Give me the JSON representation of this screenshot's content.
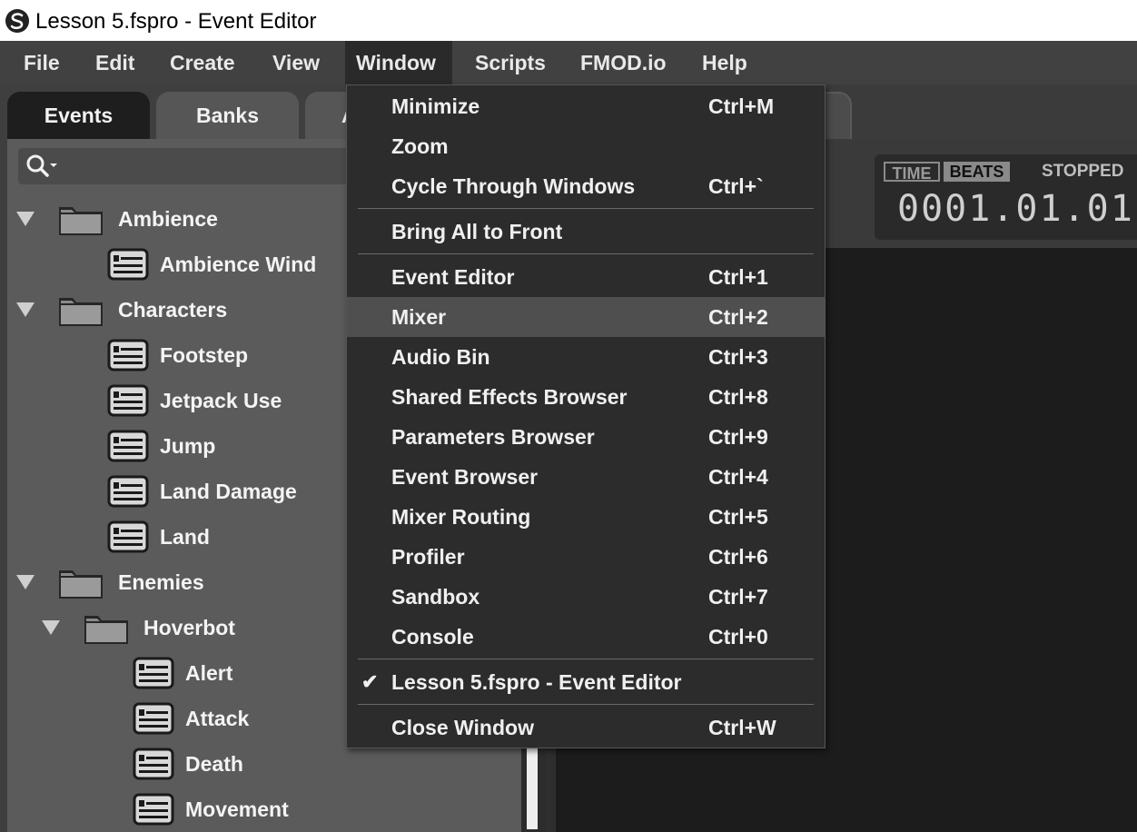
{
  "window": {
    "title": "Lesson 5.fspro - Event Editor"
  },
  "menubar": {
    "items": [
      "File",
      "Edit",
      "Create",
      "View",
      "Window",
      "Scripts",
      "FMOD.io",
      "Help"
    ],
    "open": "Window"
  },
  "browser": {
    "tabs": [
      "Events",
      "Banks",
      "A"
    ],
    "active_tab": "Events",
    "tree": [
      {
        "label": "Ambience",
        "type": "folder",
        "depth": 0,
        "expanded": true
      },
      {
        "label": "Ambience Wind",
        "type": "event",
        "depth": 1
      },
      {
        "label": "Characters",
        "type": "folder",
        "depth": 0,
        "expanded": true
      },
      {
        "label": "Footstep",
        "type": "event",
        "depth": 1
      },
      {
        "label": "Jetpack Use",
        "type": "event",
        "depth": 1
      },
      {
        "label": "Jump",
        "type": "event",
        "depth": 1
      },
      {
        "label": "Land Damage",
        "type": "event",
        "depth": 1
      },
      {
        "label": "Land",
        "type": "event",
        "depth": 1
      },
      {
        "label": "Enemies",
        "type": "folder",
        "depth": 0,
        "expanded": true
      },
      {
        "label": "Hoverbot",
        "type": "folder",
        "depth": 1,
        "expanded": true
      },
      {
        "label": "Alert",
        "type": "event",
        "depth": 2
      },
      {
        "label": "Attack",
        "type": "event",
        "depth": 2
      },
      {
        "label": "Death",
        "type": "event",
        "depth": 2
      },
      {
        "label": "Movement",
        "type": "event",
        "depth": 2
      }
    ]
  },
  "transport": {
    "time_label": "TIME",
    "beats_label": "BEATS",
    "status": "STOPPED",
    "position": "0001.01.01"
  },
  "window_menu": {
    "items": [
      {
        "label": "Minimize",
        "shortcut": "Ctrl+M"
      },
      {
        "label": "Zoom",
        "shortcut": ""
      },
      {
        "label": "Cycle Through Windows",
        "shortcut": "Ctrl+`"
      },
      {
        "label": "Bring All to Front",
        "shortcut": ""
      },
      {
        "label": "Event Editor",
        "shortcut": "Ctrl+1"
      },
      {
        "label": "Mixer",
        "shortcut": "Ctrl+2",
        "highlighted": true
      },
      {
        "label": "Audio Bin",
        "shortcut": "Ctrl+3"
      },
      {
        "label": "Shared Effects Browser",
        "shortcut": "Ctrl+8"
      },
      {
        "label": "Parameters Browser",
        "shortcut": "Ctrl+9"
      },
      {
        "label": "Event Browser",
        "shortcut": "Ctrl+4"
      },
      {
        "label": "Mixer Routing",
        "shortcut": "Ctrl+5"
      },
      {
        "label": "Profiler",
        "shortcut": "Ctrl+6"
      },
      {
        "label": "Sandbox",
        "shortcut": "Ctrl+7"
      },
      {
        "label": "Console",
        "shortcut": "Ctrl+0"
      },
      {
        "label": "Lesson 5.fspro - Event Editor",
        "shortcut": "",
        "checked": true
      },
      {
        "label": "Close Window",
        "shortcut": "Ctrl+W"
      }
    ]
  },
  "colors": {
    "menu_bg": "#2c2c2c",
    "menu_highlight": "#4f4f4f",
    "menubar_bg": "#414141",
    "tree_bg": "#5b5b5b",
    "editor_bg": "#1c1c1c"
  }
}
